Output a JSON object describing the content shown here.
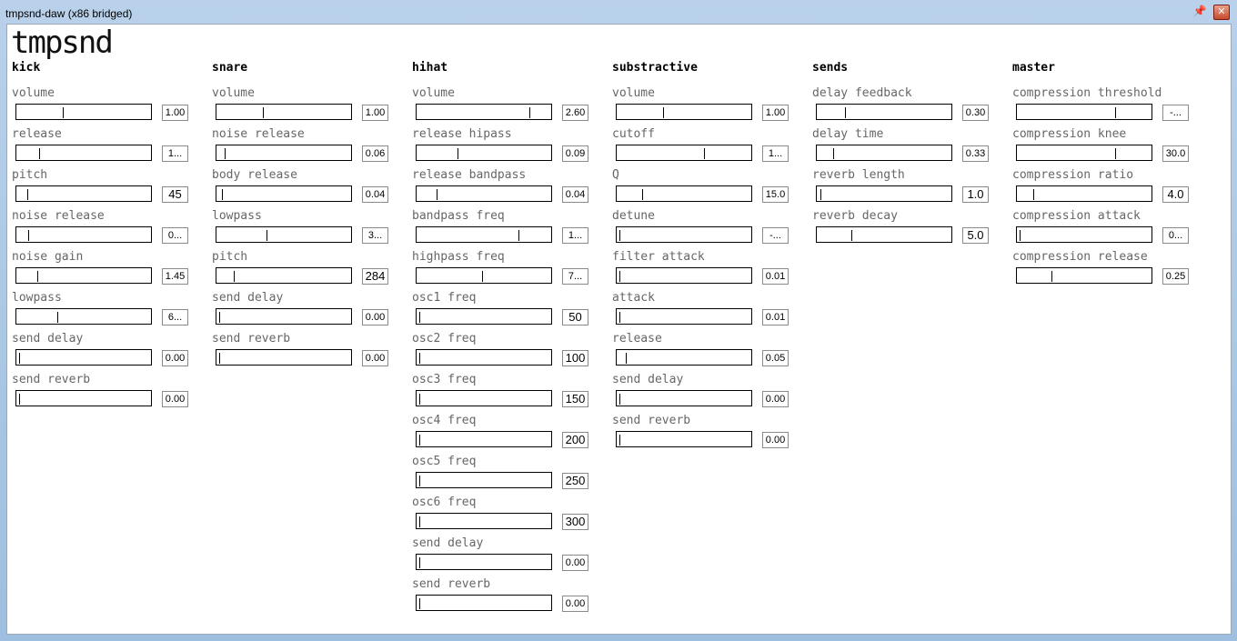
{
  "window": {
    "title": "tmpsnd-daw (x86 bridged)"
  },
  "logo": "tmpsnd",
  "columns": [
    {
      "name": "kick",
      "params": [
        {
          "label": "volume",
          "value": "1.00",
          "pos": 0.35
        },
        {
          "label": "release",
          "value": "1...",
          "pos": 0.17
        },
        {
          "label": "pitch",
          "value": "45",
          "pos": 0.08
        },
        {
          "label": "noise release",
          "value": "0...",
          "pos": 0.09
        },
        {
          "label": "noise gain",
          "value": "1.45",
          "pos": 0.16
        },
        {
          "label": "lowpass",
          "value": "6...",
          "pos": 0.31
        },
        {
          "label": "send delay",
          "value": "0.00",
          "pos": 0.02
        },
        {
          "label": "send reverb",
          "value": "0.00",
          "pos": 0.02
        }
      ]
    },
    {
      "name": "snare",
      "params": [
        {
          "label": "volume",
          "value": "1.00",
          "pos": 0.35
        },
        {
          "label": "noise release",
          "value": "0.06",
          "pos": 0.06
        },
        {
          "label": "body release",
          "value": "0.04",
          "pos": 0.04
        },
        {
          "label": "lowpass",
          "value": "3...",
          "pos": 0.38
        },
        {
          "label": "pitch",
          "value": "284",
          "pos": 0.13
        },
        {
          "label": "send delay",
          "value": "0.00",
          "pos": 0.02
        },
        {
          "label": "send reverb",
          "value": "0.00",
          "pos": 0.02
        }
      ]
    },
    {
      "name": "hihat",
      "params": [
        {
          "label": "volume",
          "value": "2.60",
          "pos": 0.85
        },
        {
          "label": "release hipass",
          "value": "0.09",
          "pos": 0.31
        },
        {
          "label": "release bandpass",
          "value": "0.04",
          "pos": 0.15
        },
        {
          "label": "bandpass freq",
          "value": "1...",
          "pos": 0.77
        },
        {
          "label": "highpass freq",
          "value": "7...",
          "pos": 0.49
        },
        {
          "label": "osc1 freq",
          "value": "50",
          "pos": 0.02
        },
        {
          "label": "osc2 freq",
          "value": "100",
          "pos": 0.02
        },
        {
          "label": "osc3 freq",
          "value": "150",
          "pos": 0.02
        },
        {
          "label": "osc4 freq",
          "value": "200",
          "pos": 0.02
        },
        {
          "label": "osc5 freq",
          "value": "250",
          "pos": 0.02
        },
        {
          "label": "osc6 freq",
          "value": "300",
          "pos": 0.02
        },
        {
          "label": "send delay",
          "value": "0.00",
          "pos": 0.02
        },
        {
          "label": "send reverb",
          "value": "0.00",
          "pos": 0.02
        }
      ]
    },
    {
      "name": "substractive",
      "params": [
        {
          "label": "volume",
          "value": "1.00",
          "pos": 0.35
        },
        {
          "label": "cutoff",
          "value": "1...",
          "pos": 0.66
        },
        {
          "label": "Q",
          "value": "15.0",
          "pos": 0.19
        },
        {
          "label": "detune",
          "value": "-...",
          "pos": 0.02
        },
        {
          "label": "filter attack",
          "value": "0.01",
          "pos": 0.02
        },
        {
          "label": "attack",
          "value": "0.01",
          "pos": 0.02
        },
        {
          "label": "release",
          "value": "0.05",
          "pos": 0.07
        },
        {
          "label": "send delay",
          "value": "0.00",
          "pos": 0.02
        },
        {
          "label": "send reverb",
          "value": "0.00",
          "pos": 0.02
        }
      ]
    },
    {
      "name": "sends",
      "params": [
        {
          "label": "delay feedback",
          "value": "0.30",
          "pos": 0.21
        },
        {
          "label": "delay time",
          "value": "0.33",
          "pos": 0.12
        },
        {
          "label": "reverb length",
          "value": "1.0",
          "pos": 0.03
        },
        {
          "label": "reverb decay",
          "value": "5.0",
          "pos": 0.26
        }
      ]
    },
    {
      "name": "master",
      "params": [
        {
          "label": "compression threshold",
          "value": "-...",
          "pos": 0.74
        },
        {
          "label": "compression knee",
          "value": "30.0",
          "pos": 0.74
        },
        {
          "label": "compression ratio",
          "value": "4.0",
          "pos": 0.12
        },
        {
          "label": "compression attack",
          "value": "0...",
          "pos": 0.02
        },
        {
          "label": "compression release",
          "value": "0.25",
          "pos": 0.26
        }
      ]
    }
  ]
}
